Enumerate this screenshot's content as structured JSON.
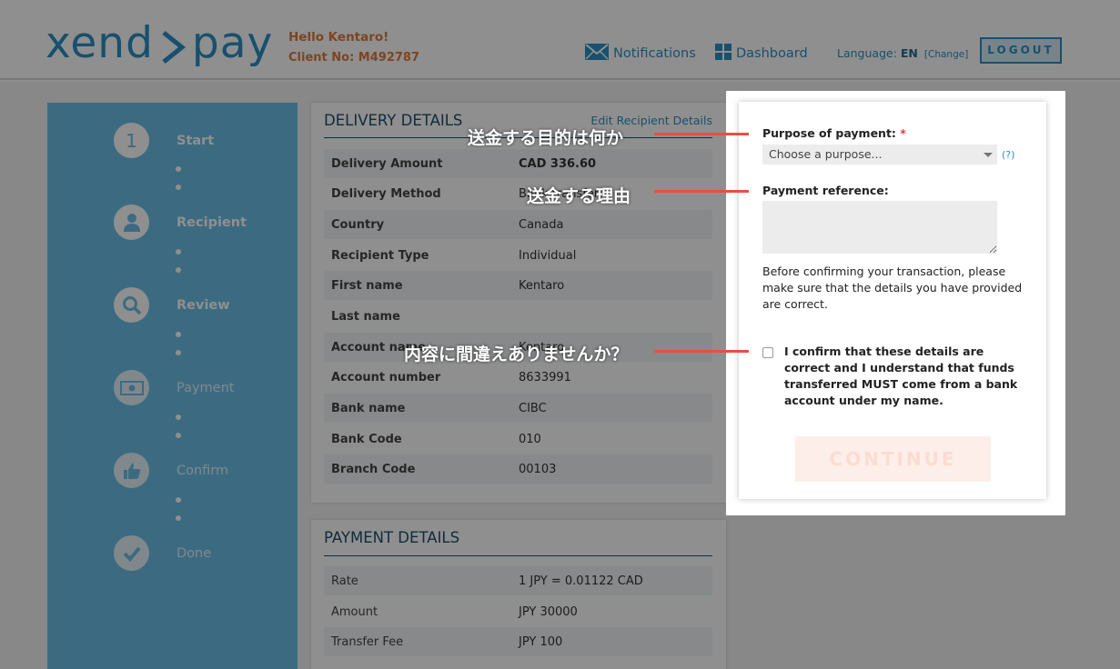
{
  "header": {
    "logo_left": "xend",
    "logo_right": "pay",
    "greeting": "Hello Kentaro!",
    "client_no": "Client No: M492787",
    "notifications": "Notifications",
    "dashboard": "Dashboard",
    "language_label": "Language:",
    "language_code": "EN",
    "language_change": "[Change]",
    "logout": "LOGOUT"
  },
  "steps": [
    {
      "number": "1",
      "label": "Start",
      "icon": "number-1-icon"
    },
    {
      "label": "Recipient",
      "icon": "person-icon"
    },
    {
      "label": "Review",
      "icon": "magnifier-icon"
    },
    {
      "label": "Payment",
      "icon": "banknote-icon"
    },
    {
      "label": "Confirm",
      "icon": "thumbs-up-icon"
    },
    {
      "label": "Done",
      "icon": "checkmark-icon"
    }
  ],
  "delivery": {
    "title": "DELIVERY DETAILS",
    "edit_link": "Edit Recipient Details",
    "rows": [
      {
        "key": "Delivery Amount",
        "value": "CAD 336.60"
      },
      {
        "key": "Delivery Method",
        "value": "Bank transfer"
      },
      {
        "key": "Country",
        "value": "Canada"
      },
      {
        "key": "Recipient Type",
        "value": "Individual"
      },
      {
        "key": "First name",
        "value": "Kentaro"
      },
      {
        "key": "Last name",
        "value": ""
      },
      {
        "key": "Account name",
        "value": "Kentaro"
      },
      {
        "key": "Account number",
        "value": "8633991"
      },
      {
        "key": "Bank name",
        "value": "CIBC"
      },
      {
        "key": "Bank Code",
        "value": "010"
      },
      {
        "key": "Branch Code",
        "value": "00103"
      }
    ]
  },
  "payment": {
    "title": "PAYMENT DETAILS",
    "rows": [
      {
        "key": "Rate",
        "value": "1 JPY = 0.01122 CAD"
      },
      {
        "key": "Amount",
        "value": "JPY 30000"
      },
      {
        "key": "Transfer Fee",
        "value": "JPY 100"
      }
    ]
  },
  "form": {
    "purpose_label": "Purpose of payment:",
    "required_mark": "*",
    "purpose_placeholder": "Choose a purpose...",
    "help": "(?)",
    "reference_label": "Payment reference:",
    "note": "Before confirming your transaction, please make sure that the details you have provided are correct.",
    "confirm_text": "I confirm that these details are correct and I understand that funds transferred MUST come from a bank account under my name.",
    "continue": "CONTINUE"
  },
  "annotations": {
    "purpose": "送金する目的は何か",
    "reference": "送金する理由",
    "confirm": "内容に間違えありませんか？"
  },
  "colors": {
    "brand_blue": "#2b8fc4",
    "sidebar_blue": "#6cbfe6",
    "greeting_orange": "#e07a3a",
    "annotation_red": "#e8503f",
    "required_red": "#e23b3b"
  }
}
